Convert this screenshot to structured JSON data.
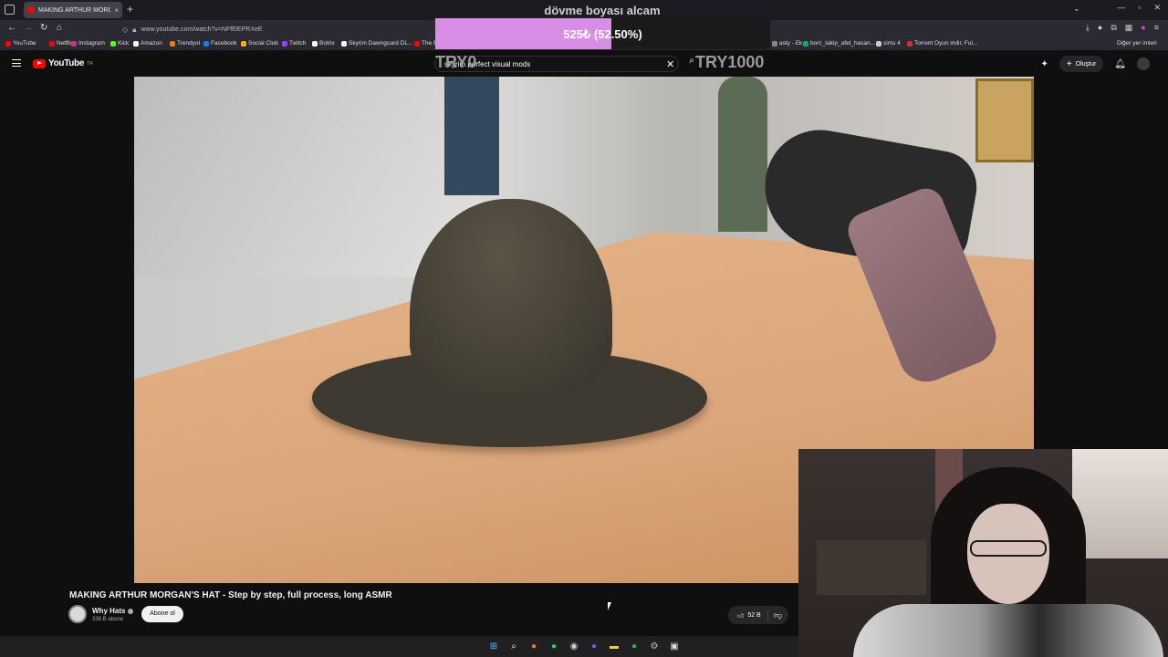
{
  "browser": {
    "tab_title": "MAKING ARTHUR MORGAN'S HAT",
    "tab_close": "×",
    "new_tab": "+",
    "url": "www.youtube.com/watch?v=NFff0EPRXeE",
    "bookmarks": [
      {
        "label": "YouTube",
        "color": "#ff0000"
      },
      {
        "label": "Netflix",
        "color": "#e50914"
      },
      {
        "label": "Instagram",
        "color": "#c13584"
      },
      {
        "label": "Kick",
        "color": "#53fc18"
      },
      {
        "label": "Amazon",
        "color": "#ffffff"
      },
      {
        "label": "Trendyol",
        "color": "#f27a1a"
      },
      {
        "label": "Facebook",
        "color": "#1877f2"
      },
      {
        "label": "Social Club",
        "color": "#fcaf17"
      },
      {
        "label": "Twitch",
        "color": "#9146ff"
      },
      {
        "label": "Botrix",
        "color": "#ffffff"
      },
      {
        "label": "Skyrim Dawnguard DL...",
        "color": "#ffffff"
      },
      {
        "label": "The E...",
        "color": "#ff0000"
      }
    ],
    "bookmarks_right": [
      {
        "label": "asty - Ek...",
        "color": "#888888"
      },
      {
        "label": "borc_takip_afet_hasan...",
        "color": "#21a366"
      },
      {
        "label": "sims 4",
        "color": "#cccccc"
      },
      {
        "label": "Torrent Oyun indir, Ful...",
        "color": "#cc3333"
      }
    ],
    "other_bookmarks": "Diğer yer imleri"
  },
  "overlay": {
    "title": "dövme boyası alcam",
    "goal_text": "525₺ (52.50%)",
    "goal_percent": 52.5,
    "goal_min": "TRY0",
    "goal_max": "TRY1000",
    "fill_color": "#d98ee6"
  },
  "youtube": {
    "logo": "YouTube",
    "logo_suffix": "TR",
    "search_value": "skyrim perfect visual mods",
    "create_label": "Oluştur"
  },
  "video": {
    "title": "MAKING ARTHUR MORGAN'S HAT - Step by step, full process, long ASMR",
    "channel": "Why Hats",
    "subscribers": "338 B abone",
    "subscribe_label": "Abone ol",
    "likes": "52 B"
  },
  "taskbar": {
    "icons": [
      "windows-icon",
      "search-icon",
      "firefox-icon",
      "whatsapp-icon",
      "steam-icon",
      "discord-icon",
      "folder-icon",
      "spotify-icon",
      "settings-icon",
      "terminal-icon"
    ]
  }
}
